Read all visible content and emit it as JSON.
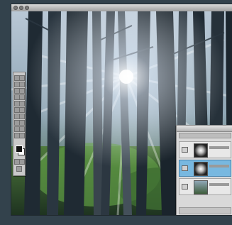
{
  "window": {
    "title": ""
  },
  "layers_panel": {
    "title": "",
    "layers": [
      {
        "thumbnail": "light-burst",
        "selected": false
      },
      {
        "thumbnail": "light-burst",
        "selected": true
      },
      {
        "thumbnail": "forest-photo",
        "selected": false
      }
    ]
  },
  "colors": {
    "frame_background": "#33424c",
    "selected_layer": "#78b8e0",
    "panel_gray": "#d9d9d9"
  },
  "icons": {
    "toolbox": "toolbox-icon",
    "eye": "eye-icon"
  }
}
